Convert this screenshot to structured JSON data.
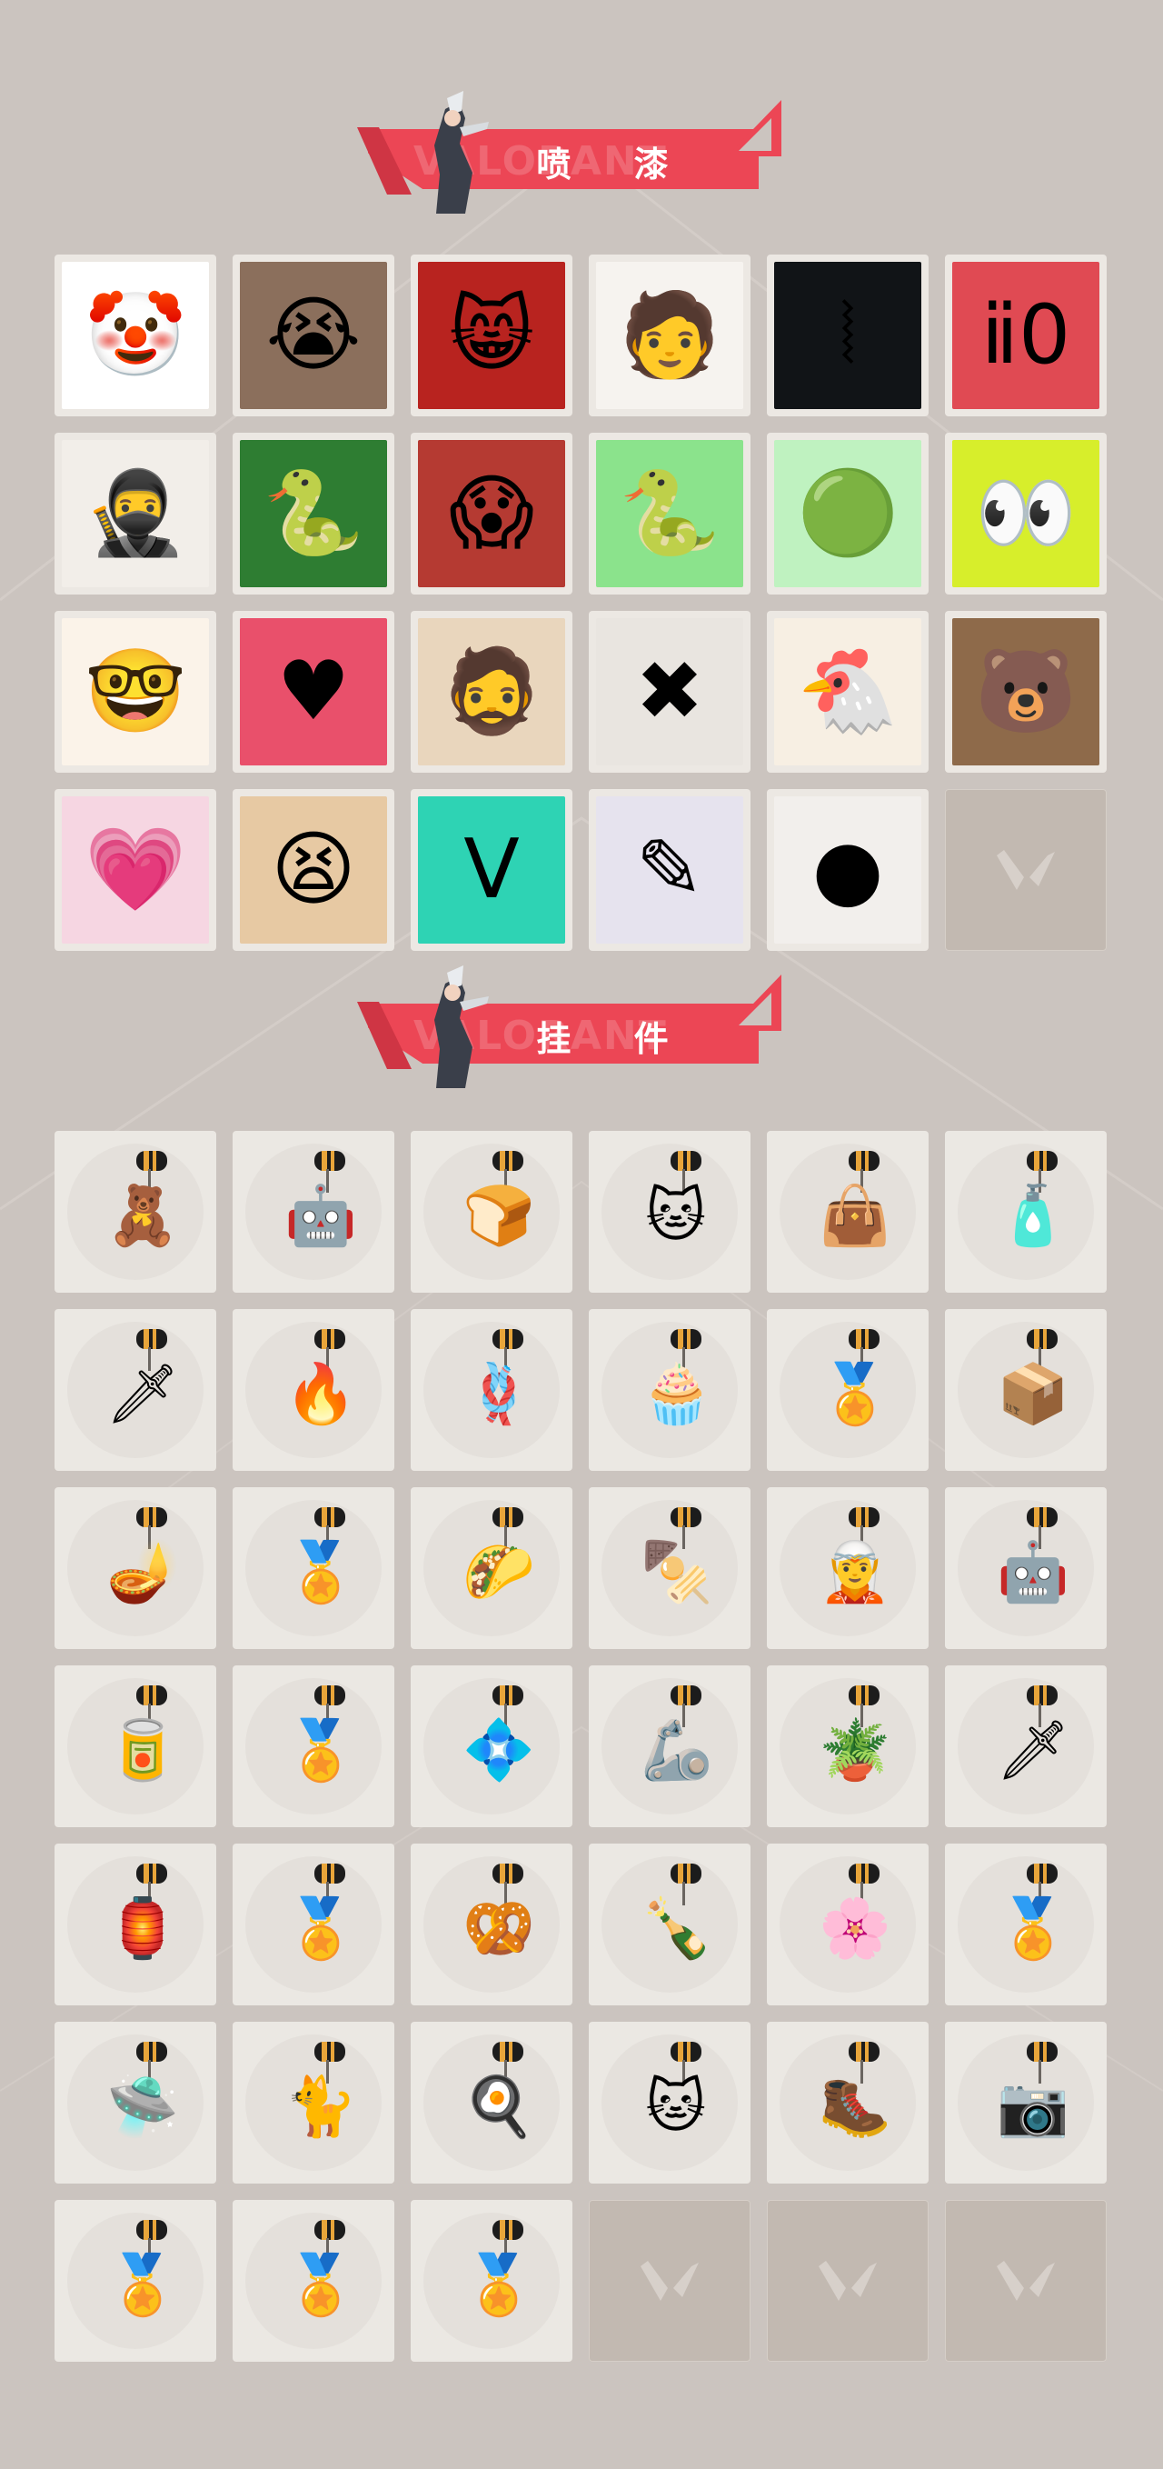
{
  "sections": {
    "sprays": {
      "title": "喷 漆",
      "watermark": "VALORANT",
      "items": [
        {
          "icon": "clown-face-icon",
          "glyph": "🤡",
          "bg": "#ffffff"
        },
        {
          "icon": "crying-mole-icon",
          "glyph": "😭",
          "bg": "#8b6f5c"
        },
        {
          "icon": "laughing-cat-icon",
          "glyph": "😸",
          "bg": "#b8231f"
        },
        {
          "icon": "hooded-agent-icon",
          "glyph": "🧑",
          "bg": "#f6f3ef"
        },
        {
          "icon": "neon-claw-icon",
          "glyph": "⦚",
          "bg": "#111417"
        },
        {
          "icon": "ammo-zero-icon",
          "glyph": "ⅱ0",
          "bg": "#e04a53"
        },
        {
          "icon": "number-01-agent-icon",
          "glyph": "🥷",
          "bg": "#f2eee9"
        },
        {
          "icon": "viper-graffiti-icon",
          "glyph": "🐍",
          "bg": "#2e7d32"
        },
        {
          "icon": "screaming-mole-icon",
          "glyph": "😱",
          "bg": "#b53a32"
        },
        {
          "icon": "green-snake-icon",
          "glyph": "🐍",
          "bg": "#8be38c"
        },
        {
          "icon": "green-orb-icon",
          "glyph": "🟢",
          "bg": "#bff2c0"
        },
        {
          "icon": "slime-eyes-icon",
          "glyph": "👀",
          "bg": "#d7ee2b"
        },
        {
          "icon": "glasses-guy-icon",
          "glyph": "🤓",
          "bg": "#fbf3e9"
        },
        {
          "icon": "pixel-heart-icon",
          "glyph": "♥",
          "bg": "#e9506b"
        },
        {
          "icon": "bearded-face-icon",
          "glyph": "🧔",
          "bg": "#e9d6bd"
        },
        {
          "icon": "red-x-icon",
          "glyph": "✖",
          "bg": "#e9e5e0"
        },
        {
          "icon": "crowned-bird-icon",
          "glyph": "🐔",
          "bg": "#f7efe3"
        },
        {
          "icon": "sunglasses-bear-icon",
          "glyph": "🐻",
          "bg": "#8e6a4a"
        },
        {
          "icon": "neon-heart-icon",
          "glyph": "💗",
          "bg": "#f6d6e2"
        },
        {
          "icon": "shouting-man-icon",
          "glyph": "😫",
          "bg": "#e7c9a3"
        },
        {
          "icon": "valorant-logo-icon",
          "glyph": "V",
          "bg": "#2ed3b4"
        },
        {
          "icon": "purple-graffiti-icon",
          "glyph": "✎",
          "bg": "#e6e3ee"
        },
        {
          "icon": "red-dripping-logo-icon",
          "glyph": "●",
          "bg": "#f2efec"
        },
        {
          "icon": "empty-slot-icon",
          "glyph": "",
          "bg": ""
        }
      ]
    },
    "buddies": {
      "title": "挂 件",
      "watermark": "VALORANT",
      "items": [
        {
          "icon": "golden-bear-charm-icon",
          "glyph": "🧸"
        },
        {
          "icon": "drone-bot-charm-icon",
          "glyph": "🤖"
        },
        {
          "icon": "toaster-charm-icon",
          "glyph": "🍞"
        },
        {
          "icon": "astronaut-cat-charm-icon",
          "glyph": "🐱"
        },
        {
          "icon": "bag-charm-icon",
          "glyph": "👜"
        },
        {
          "icon": "blue-canister-charm-icon",
          "glyph": "🧴"
        },
        {
          "icon": "spiked-blade-charm-icon",
          "glyph": "🗡"
        },
        {
          "icon": "fire-cat-charm-icon",
          "glyph": "🔥"
        },
        {
          "icon": "braided-rope-charm-icon",
          "glyph": "🪢"
        },
        {
          "icon": "cupcake-charm-icon",
          "glyph": "🧁"
        },
        {
          "icon": "ep9-medal-charm-icon",
          "glyph": "🏅"
        },
        {
          "icon": "book-case-charm-icon",
          "glyph": "📦"
        },
        {
          "icon": "lava-lamp-charm-icon",
          "glyph": "🪔"
        },
        {
          "icon": "ep9-token-charm-icon",
          "glyph": "🏅"
        },
        {
          "icon": "nacho-charm-icon",
          "glyph": "🌮"
        },
        {
          "icon": "skewer-charm-icon",
          "glyph": "🍢"
        },
        {
          "icon": "agent-figure-charm-icon",
          "glyph": "🧝"
        },
        {
          "icon": "robot-head-charm-icon",
          "glyph": "🤖"
        },
        {
          "icon": "soda-can-charm-icon",
          "glyph": "🥫"
        },
        {
          "icon": "ep9-blue-token-charm-icon",
          "glyph": "🏅"
        },
        {
          "icon": "silver-diamond-charm-icon",
          "glyph": "💠"
        },
        {
          "icon": "golden-mech-charm-icon",
          "glyph": "🦾"
        },
        {
          "icon": "green-plant-charm-icon",
          "glyph": "🪴"
        },
        {
          "icon": "crystal-sword-charm-icon",
          "glyph": "🗡"
        },
        {
          "icon": "lantern-charm-icon",
          "glyph": "🏮"
        },
        {
          "icon": "ep8-green-token-charm-icon",
          "glyph": "🏅"
        },
        {
          "icon": "pretzel-charm-icon",
          "glyph": "🥨"
        },
        {
          "icon": "bottle-charm-icon",
          "glyph": "🍾"
        },
        {
          "icon": "flame-flower-charm-icon",
          "glyph": "🌸"
        },
        {
          "icon": "ep8-purple-token-charm-icon",
          "glyph": "🏅"
        },
        {
          "icon": "ufo-charm-icon",
          "glyph": "🛸"
        },
        {
          "icon": "orange-cat-charm-icon",
          "glyph": "🐈"
        },
        {
          "icon": "fried-egg-charm-icon",
          "glyph": "🍳"
        },
        {
          "icon": "grey-cat-charm-icon",
          "glyph": "🐱"
        },
        {
          "icon": "boot-charm-icon",
          "glyph": "🥾"
        },
        {
          "icon": "camera-box-charm-icon",
          "glyph": "📷"
        },
        {
          "icon": "ep8-blue-token-charm-icon",
          "glyph": "🏅"
        },
        {
          "icon": "ep7-token-charm-icon",
          "glyph": "🏅"
        },
        {
          "icon": "v-logo-token-charm-icon",
          "glyph": "🏅"
        },
        {
          "icon": "empty-slot-icon",
          "glyph": ""
        },
        {
          "icon": "empty-slot-icon",
          "glyph": ""
        },
        {
          "icon": "empty-slot-icon",
          "glyph": ""
        }
      ]
    }
  },
  "colors": {
    "background": "#cbc4bf",
    "accent": "#ec4655",
    "tile": "#ebe8e3",
    "empty": "#c2b9b1"
  }
}
